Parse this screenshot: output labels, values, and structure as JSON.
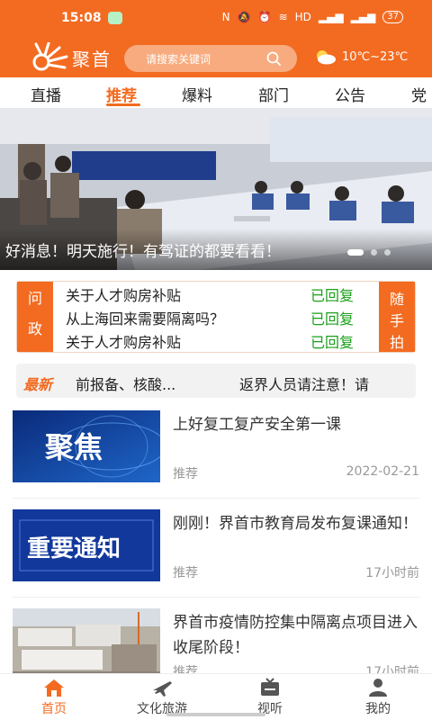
{
  "status_bar": {
    "time": "15:08",
    "network": "N",
    "signal": "HD",
    "battery": "37"
  },
  "header": {
    "brand": "聚首",
    "search_placeholder": "请搜索关键词",
    "weather": "10℃~23℃"
  },
  "tabs": [
    {
      "label": "直播"
    },
    {
      "label": "推荐"
    },
    {
      "label": "爆料"
    },
    {
      "label": "部门"
    },
    {
      "label": "公告"
    },
    {
      "label": "党建"
    }
  ],
  "banner": {
    "caption": "好消息！明天施行！有驾证的都要看看！"
  },
  "wenzheng": {
    "left_label": [
      "问",
      "政"
    ],
    "right_label": [
      "随",
      "手",
      "拍"
    ],
    "rows": [
      {
        "question": "关于人才购房补贴",
        "status": "已回复"
      },
      {
        "question": "从上海回来需要隔离吗？",
        "status": "已回复"
      },
      {
        "question": "关于人才购房补贴",
        "status": "已回复"
      }
    ]
  },
  "ticker": {
    "tag": "最新",
    "items": [
      "前报备、核酸...",
      "返界人员请注意！请"
    ]
  },
  "news": [
    {
      "thumb_text": "聚焦",
      "title": "上好复工复产安全第一课",
      "source": "推荐",
      "time": "2022-02-21"
    },
    {
      "thumb_text": "重要通知",
      "title": "刚刚！界首市教育局发布复课通知！",
      "source": "推荐",
      "time": "17小时前"
    },
    {
      "thumb_text": "",
      "title": "界首市疫情防控集中隔离点项目进入收尾阶段！",
      "source": "推荐",
      "time": "17小时前"
    }
  ],
  "bottom_nav": [
    {
      "label": "首页",
      "icon": "home-icon"
    },
    {
      "label": "文化旅游",
      "icon": "plane-icon"
    },
    {
      "label": "视听",
      "icon": "tv-icon"
    },
    {
      "label": "我的",
      "icon": "user-icon"
    }
  ],
  "colors": {
    "brand": "#f36b21",
    "replied": "#1aa01a"
  }
}
